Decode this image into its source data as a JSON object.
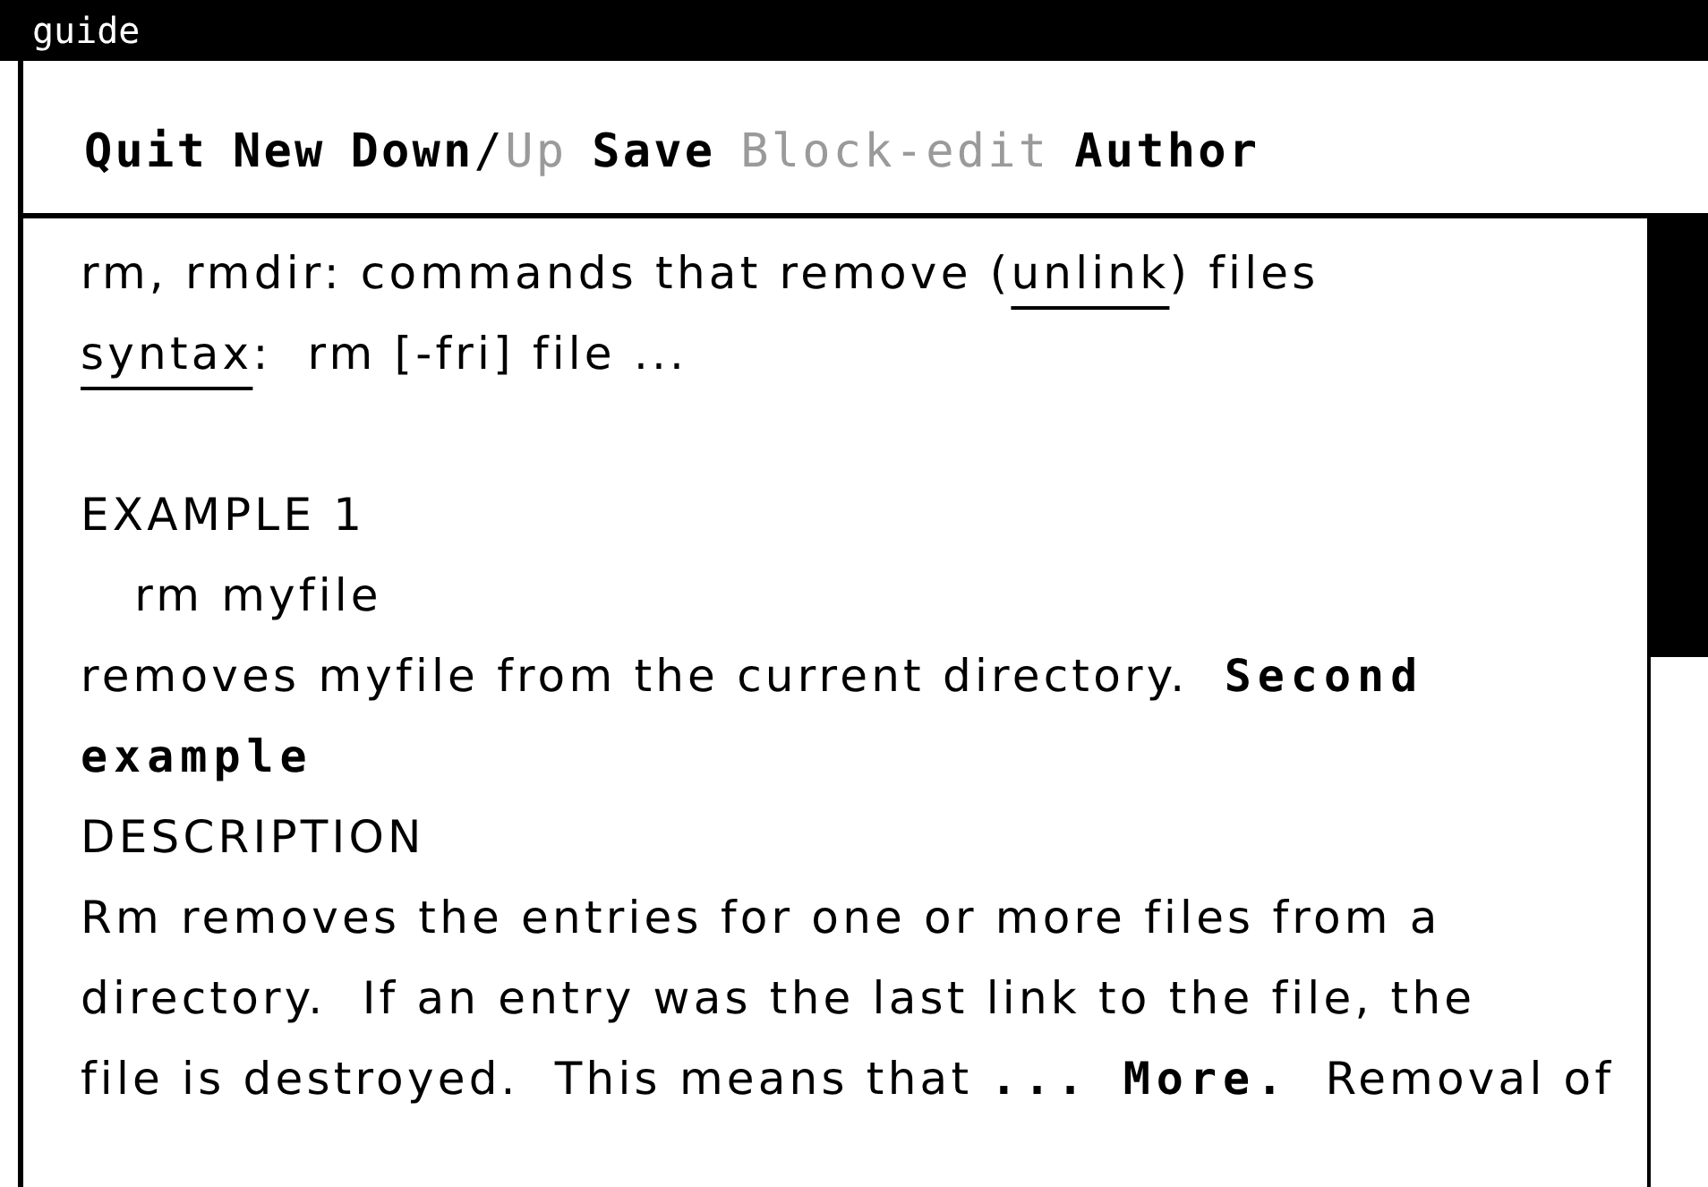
{
  "window": {
    "title": "guide"
  },
  "menu": [
    {
      "kind": "command",
      "label": "Quit",
      "disabled": false
    },
    {
      "kind": "command",
      "label": "New",
      "disabled": false
    },
    {
      "kind": "pair",
      "separator": "/",
      "parts": [
        {
          "label": "Down",
          "disabled": false
        },
        {
          "label": "Up",
          "disabled": true
        }
      ]
    },
    {
      "kind": "command",
      "label": "Save",
      "disabled": false
    },
    {
      "kind": "command",
      "label": "Block-edit",
      "disabled": true
    },
    {
      "kind": "command",
      "label": "Author",
      "disabled": false
    }
  ],
  "content": {
    "lines": [
      {
        "kind": "text",
        "segments": [
          {
            "kind": "text",
            "text": "rm, rmdir: commands that remove ("
          },
          {
            "kind": "link",
            "text": "unlink"
          },
          {
            "kind": "text",
            "text": ") files"
          }
        ]
      },
      {
        "kind": "text",
        "segments": [
          {
            "kind": "link",
            "text": "syntax"
          },
          {
            "kind": "text",
            "text": ":  rm [-fri] file ..."
          }
        ]
      },
      {
        "kind": "blank"
      },
      {
        "kind": "text",
        "segments": [
          {
            "kind": "text",
            "text": "EXAMPLE 1"
          }
        ]
      },
      {
        "kind": "text",
        "segments": [
          {
            "kind": "text",
            "text": "   rm myfile"
          }
        ]
      },
      {
        "kind": "text",
        "segments": [
          {
            "kind": "text",
            "text": "removes myfile from the current directory.  "
          },
          {
            "kind": "bold-link",
            "text": "Second"
          }
        ]
      },
      {
        "kind": "text",
        "segments": [
          {
            "kind": "bold-link",
            "text": "example"
          }
        ]
      },
      {
        "kind": "text",
        "segments": [
          {
            "kind": "text",
            "text": "DESCRIPTION"
          }
        ]
      },
      {
        "kind": "text",
        "segments": [
          {
            "kind": "text",
            "text": "Rm removes the entries for one or more files from a"
          }
        ]
      },
      {
        "kind": "text",
        "segments": [
          {
            "kind": "text",
            "text": "directory.  If an entry was the last link to the file, the"
          }
        ]
      },
      {
        "kind": "text",
        "segments": [
          {
            "kind": "text",
            "text": "file is destroyed.  This means that "
          },
          {
            "kind": "bold-link",
            "text": "... More."
          },
          {
            "kind": "text",
            "text": "  Removal of"
          }
        ]
      }
    ]
  }
}
